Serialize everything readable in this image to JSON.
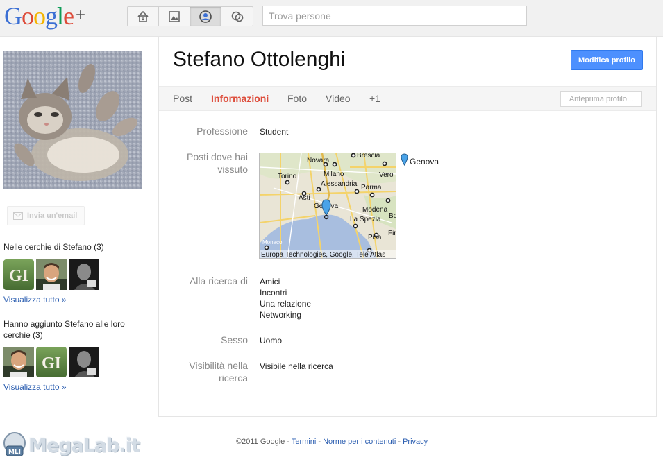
{
  "header": {
    "logo_text": "Google",
    "logo_plus": "+",
    "nav": [
      {
        "icon": "home-icon",
        "active": false
      },
      {
        "icon": "photos-icon",
        "active": false
      },
      {
        "icon": "profile-icon",
        "active": true
      },
      {
        "icon": "circles-icon",
        "active": false
      }
    ],
    "search_placeholder": "Trova persone"
  },
  "sidebar": {
    "send_email_label": "Invia un'email",
    "in_circles_title": "Nelle cerchie di Stefano (3)",
    "in_circles_view_all": "Visualizza tutto »",
    "added_title": "Hanno aggiunto Stefano alle loro cerchie (3)",
    "added_view_all": "Visualizza tutto »",
    "avatar_gi_text": "GI"
  },
  "profile": {
    "name": "Stefano Ottolenghi",
    "edit_label": "Modifica profilo",
    "tabs": [
      {
        "label": "Post",
        "active": false
      },
      {
        "label": "Informazioni",
        "active": true
      },
      {
        "label": "Foto",
        "active": false
      },
      {
        "label": "Video",
        "active": false
      },
      {
        "label": "+1",
        "active": false
      }
    ],
    "preview_label": "Anteprima profilo..."
  },
  "about": {
    "occupation_label": "Professione",
    "occupation_value": "Student",
    "places_label": "Posti dove hai vissuto",
    "places_value": "Genova",
    "map_labels": [
      "Novara",
      "Brescia",
      "Vero",
      "Milano",
      "Torino",
      "Alessandria",
      "Parma",
      "Asti",
      "Genova",
      "Modena",
      "Bo",
      "La Spezia",
      "Fir",
      "Pisa",
      "Monaco"
    ],
    "map_attribution": "Europa Technologies, Google, Tele Atlas",
    "looking_label": "Alla ricerca di",
    "looking_values": [
      "Amici",
      "Incontri",
      "Una relazione",
      "Networking"
    ],
    "gender_label": "Sesso",
    "gender_value": "Uomo",
    "visibility_label": "Visibilità nella ricerca",
    "visibility_value": "Visibile nella ricerca"
  },
  "footer": {
    "copyright": "©2011 Google",
    "sep": " - ",
    "terms": "Termini",
    "content_policy": "Norme per i contenuti",
    "privacy": "Privacy"
  },
  "watermark": {
    "text": "MegaLab.it",
    "badge": "MLI"
  },
  "colors": {
    "accent_red": "#dd4b39",
    "button_blue": "#4d90fe",
    "link_blue": "#2a5db0"
  }
}
